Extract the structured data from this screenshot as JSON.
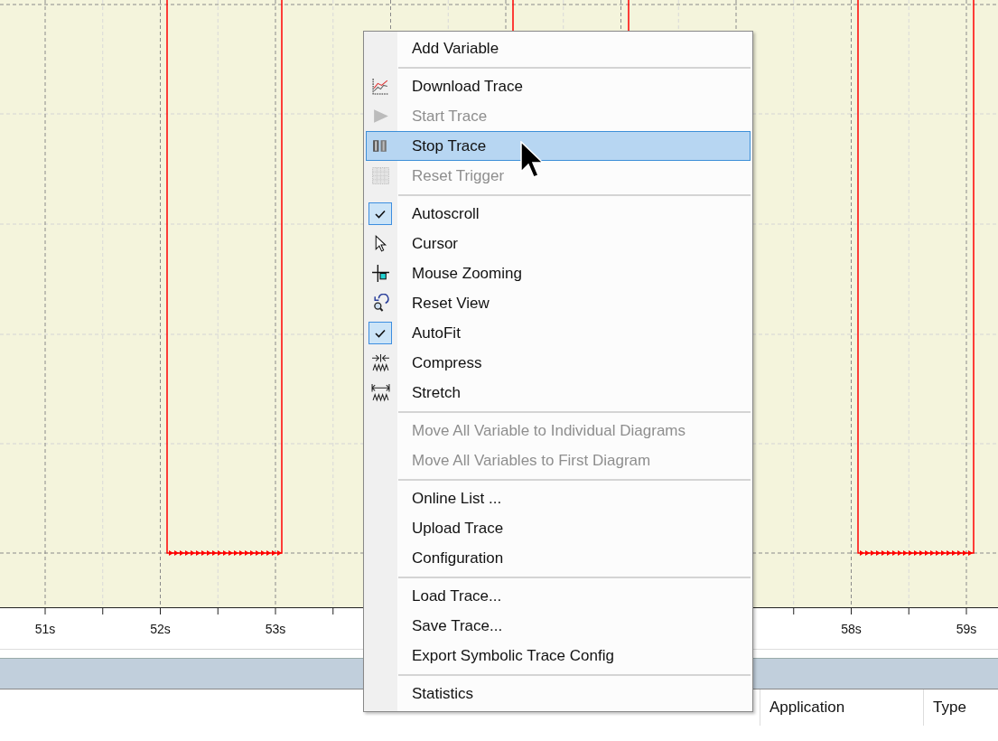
{
  "trace_axis": {
    "left_ticks": [
      "51s",
      "52s",
      "53s"
    ],
    "right_ticks": [
      "58s",
      "59s"
    ]
  },
  "table": {
    "columns": [
      "Application",
      "Type"
    ]
  },
  "context_menu": {
    "items": [
      {
        "kind": "item",
        "label": "Add Variable",
        "disabled": false,
        "selected": false,
        "checked": false
      },
      {
        "kind": "separator"
      },
      {
        "kind": "item",
        "label": "Download Trace",
        "disabled": false,
        "selected": false,
        "checked": false
      },
      {
        "kind": "item",
        "label": "Start Trace",
        "disabled": true,
        "selected": false,
        "checked": false
      },
      {
        "kind": "item",
        "label": "Stop Trace",
        "disabled": false,
        "selected": true,
        "checked": false
      },
      {
        "kind": "item",
        "label": "Reset Trigger",
        "disabled": true,
        "selected": false,
        "checked": false
      },
      {
        "kind": "separator"
      },
      {
        "kind": "item",
        "label": "Autoscroll",
        "disabled": false,
        "selected": false,
        "checked": true
      },
      {
        "kind": "item",
        "label": "Cursor",
        "disabled": false,
        "selected": false,
        "checked": false
      },
      {
        "kind": "item",
        "label": "Mouse Zooming",
        "disabled": false,
        "selected": false,
        "checked": false
      },
      {
        "kind": "item",
        "label": "Reset View",
        "disabled": false,
        "selected": false,
        "checked": false
      },
      {
        "kind": "item",
        "label": "AutoFit",
        "disabled": false,
        "selected": false,
        "checked": true
      },
      {
        "kind": "item",
        "label": "Compress",
        "disabled": false,
        "selected": false,
        "checked": false
      },
      {
        "kind": "item",
        "label": "Stretch",
        "disabled": false,
        "selected": false,
        "checked": false
      },
      {
        "kind": "separator"
      },
      {
        "kind": "item",
        "label": "Move All Variable to Individual Diagrams",
        "disabled": true,
        "selected": false,
        "checked": false
      },
      {
        "kind": "item",
        "label": "Move All Variables to First Diagram",
        "disabled": true,
        "selected": false,
        "checked": false
      },
      {
        "kind": "separator"
      },
      {
        "kind": "item",
        "label": "Online List ...",
        "disabled": false,
        "selected": false,
        "checked": false
      },
      {
        "kind": "item",
        "label": "Upload Trace",
        "disabled": false,
        "selected": false,
        "checked": false
      },
      {
        "kind": "item",
        "label": "Configuration",
        "disabled": false,
        "selected": false,
        "checked": false
      },
      {
        "kind": "separator"
      },
      {
        "kind": "item",
        "label": "Load Trace...",
        "disabled": false,
        "selected": false,
        "checked": false
      },
      {
        "kind": "item",
        "label": "Save Trace...",
        "disabled": false,
        "selected": false,
        "checked": false
      },
      {
        "kind": "item",
        "label": "Export Symbolic Trace Config",
        "disabled": false,
        "selected": false,
        "checked": false
      },
      {
        "kind": "separator"
      },
      {
        "kind": "item",
        "label": "Statistics",
        "disabled": false,
        "selected": false,
        "checked": false
      }
    ]
  }
}
